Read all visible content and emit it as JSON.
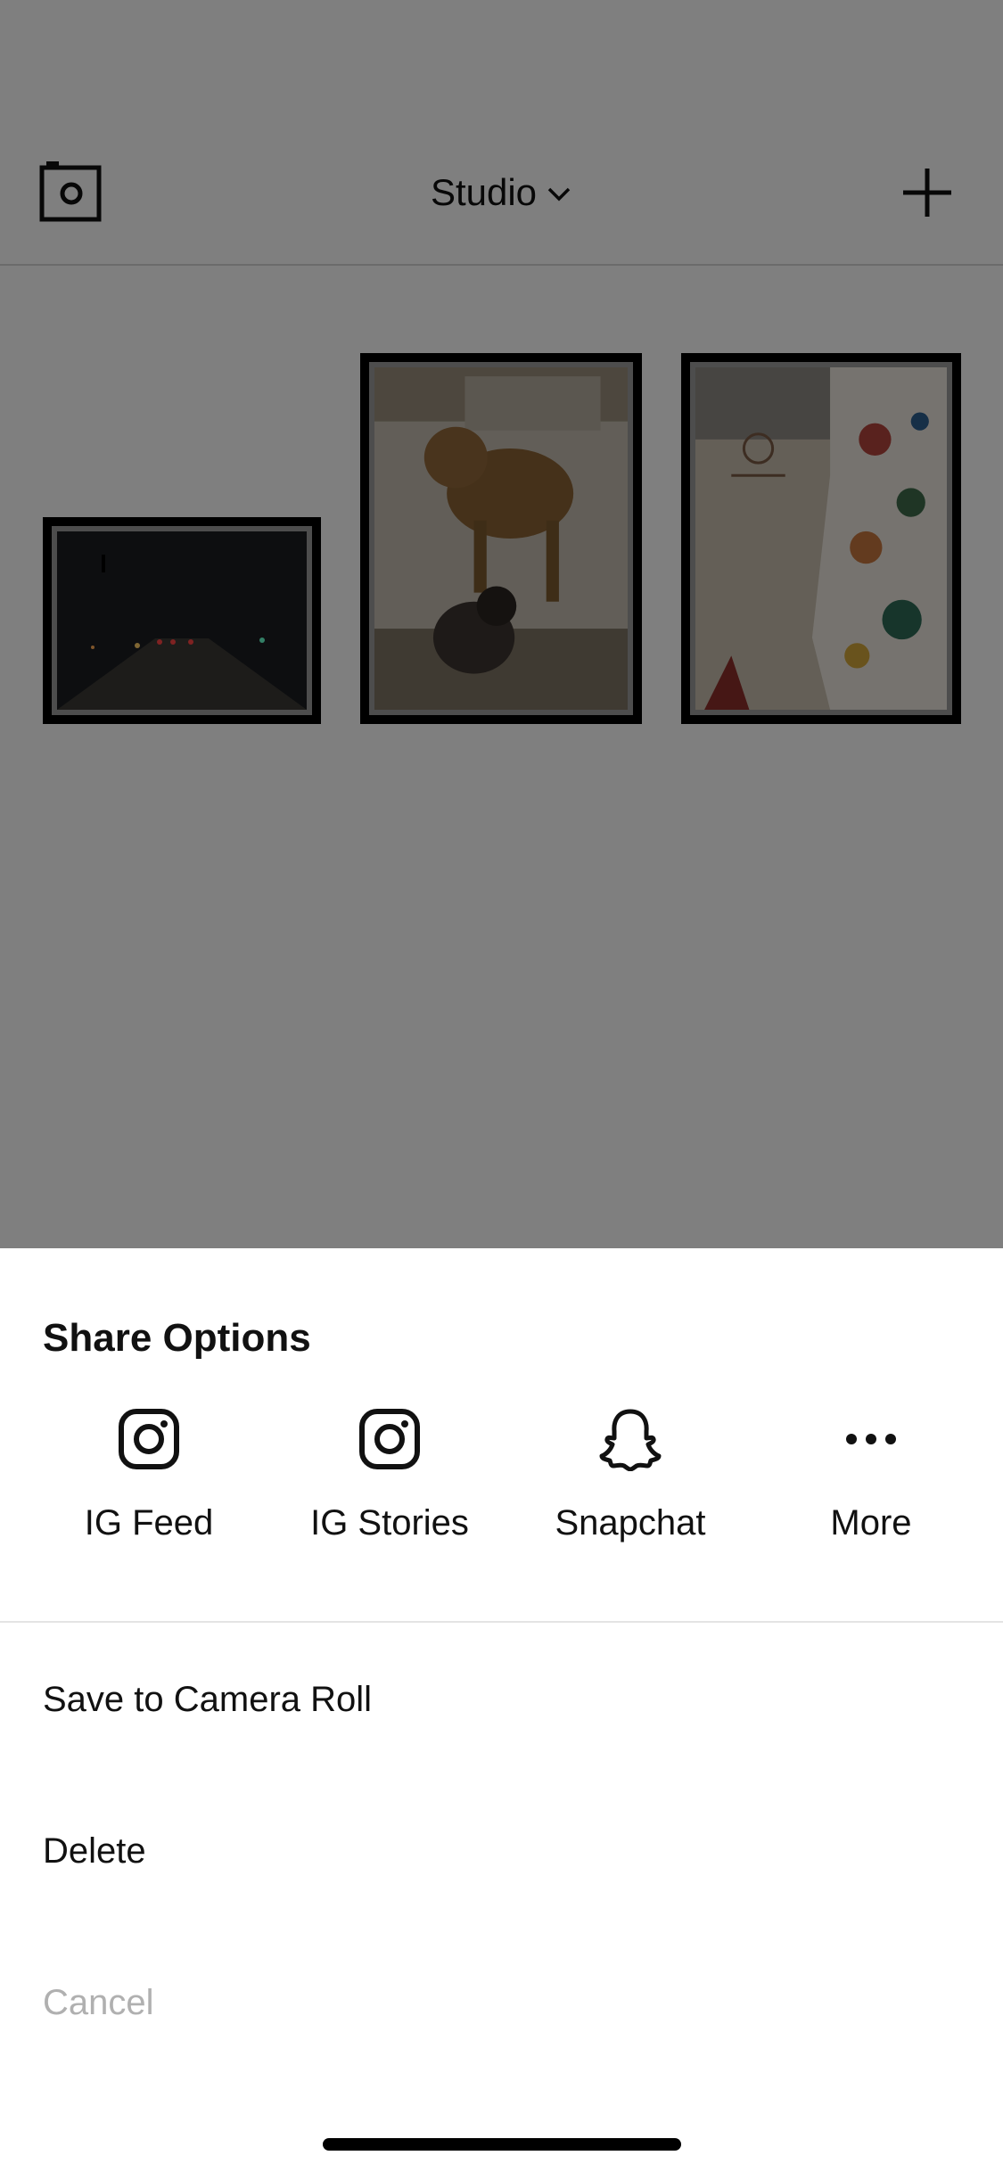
{
  "header": {
    "title": "Studio",
    "left_icon": "camera-icon",
    "title_icon": "chevron-down-icon",
    "right_icon": "plus-icon"
  },
  "gallery": {
    "items": [
      {
        "kind": "photo",
        "subject": ""
      },
      {
        "kind": "photo",
        "subject": ""
      },
      {
        "kind": "photo",
        "subject": ""
      }
    ]
  },
  "share_sheet": {
    "title": "Share Options",
    "share_targets": [
      {
        "label": "IG Feed",
        "icon": "instagram-icon"
      },
      {
        "label": "IG Stories",
        "icon": "instagram-icon"
      },
      {
        "label": "Snapchat",
        "icon": "snapchat-icon"
      },
      {
        "label": "More",
        "icon": "more-dots-icon"
      }
    ],
    "actions": [
      {
        "label": "Save to Camera Roll"
      },
      {
        "label": "Delete"
      },
      {
        "label": "Cancel"
      }
    ]
  },
  "colors": {
    "dim_overlay": "#000000",
    "text_primary": "#111111",
    "text_disabled": "#b0b0b0",
    "frame": "#000000"
  }
}
